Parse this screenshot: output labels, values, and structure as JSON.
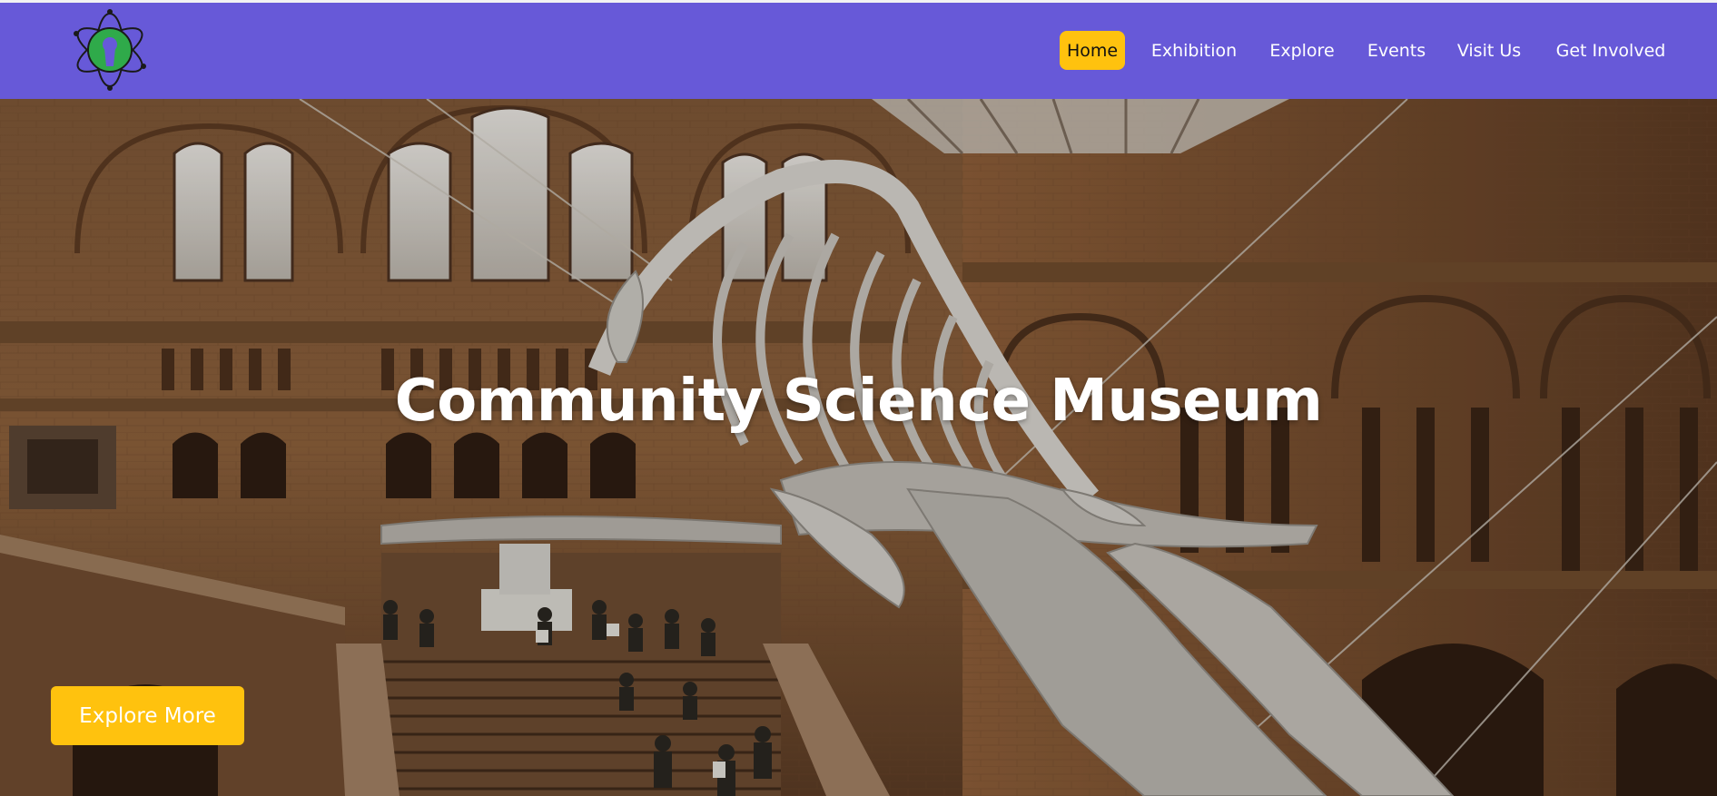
{
  "colors": {
    "navbar_bg": "#6759d8",
    "accent": "#ffc20e",
    "logo_green": "#2faa4a"
  },
  "logo": {
    "icon": "atom-keyhole-logo"
  },
  "nav": {
    "items": [
      {
        "label": "Home",
        "active": true
      },
      {
        "label": "Exhibition",
        "active": false
      },
      {
        "label": "Explore",
        "active": false
      },
      {
        "label": "Events",
        "active": false
      },
      {
        "label": "Visit Us",
        "active": false
      },
      {
        "label": "Get Involved",
        "active": false
      }
    ]
  },
  "hero": {
    "background": "museum-hall-whale-skeleton-photo",
    "title": "Community Science Museum",
    "cta_label": "Explore More"
  }
}
